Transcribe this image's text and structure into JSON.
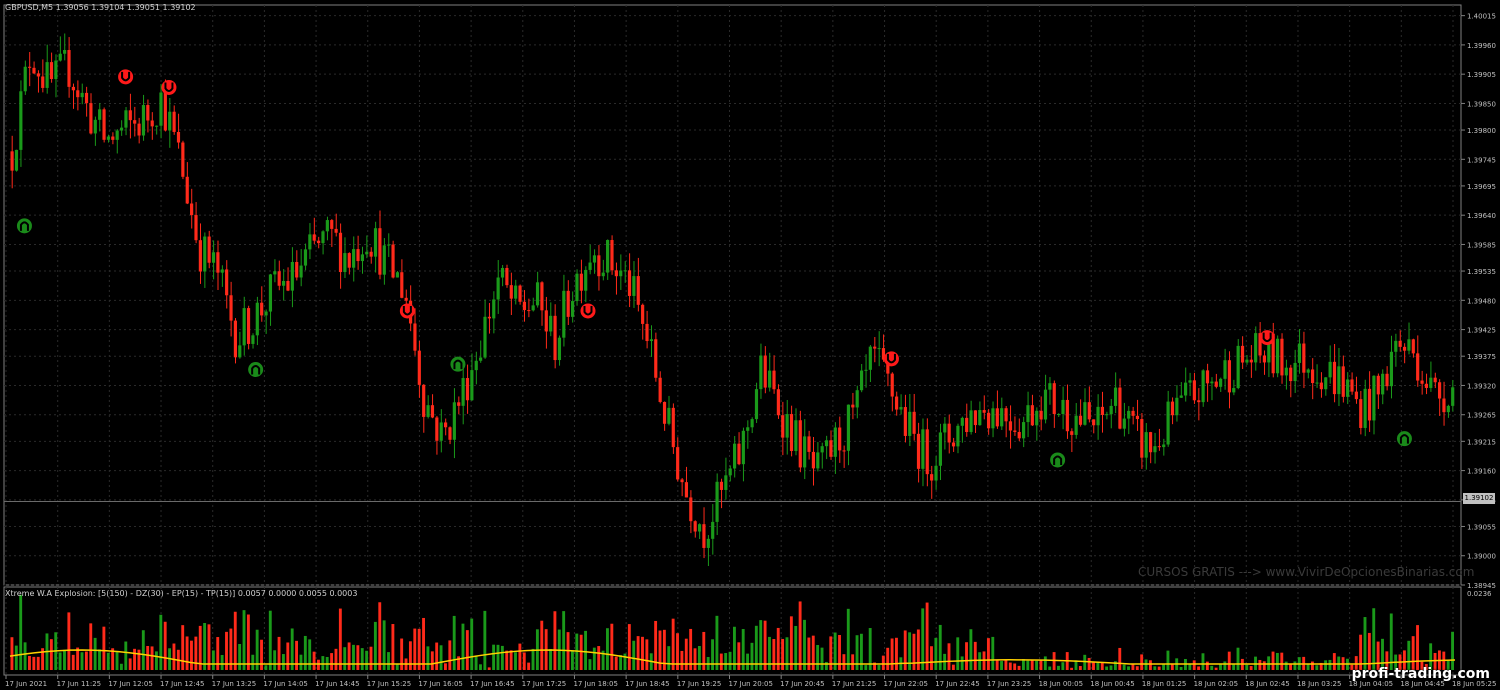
{
  "header": {
    "symbol_info": "GBPUSD,M5  1.39056 1.39104 1.39051 1.39102"
  },
  "indicator": {
    "title": "Xtreme W.A Explosion: [5(150) - DZ(30) - EP(15) - TP(15)] 0.0057 0.0000 0.0055 0.0003",
    "scale_label": "0.0236"
  },
  "watermark": "CURSOS GRATIS ---> www.VivirDeOpcionesBinarias.com",
  "brand": "profi-trading.com",
  "current_price": "1.39102",
  "colors": {
    "bull": "#1a9a1a",
    "bear": "#ff2a1a",
    "signal_line": "#ffd000",
    "grid": "#2a2a2a",
    "axis": "#808080"
  },
  "price_axis": [
    "1.40015",
    "1.39960",
    "1.39905",
    "1.39850",
    "1.39800",
    "1.39745",
    "1.39695",
    "1.39640",
    "1.39585",
    "1.39535",
    "1.39480",
    "1.39425",
    "1.39375",
    "1.39320",
    "1.39265",
    "1.39215",
    "1.39160",
    "1.39105",
    "1.39055",
    "1.39000",
    "1.38945"
  ],
  "time_axis": [
    "17 Jun 2021",
    "17 Jun 11:25",
    "17 Jun 12:05",
    "17 Jun 12:45",
    "17 Jun 13:25",
    "17 Jun 14:05",
    "17 Jun 14:45",
    "17 Jun 15:25",
    "17 Jun 16:05",
    "17 Jun 16:45",
    "17 Jun 17:25",
    "17 Jun 18:05",
    "17 Jun 18:45",
    "17 Jun 19:25",
    "17 Jun 20:05",
    "17 Jun 20:45",
    "17 Jun 21:25",
    "17 Jun 22:05",
    "17 Jun 22:45",
    "17 Jun 23:25",
    "18 Jun 00:05",
    "18 Jun 00:45",
    "18 Jun 01:25",
    "18 Jun 02:05",
    "18 Jun 02:45",
    "18 Jun 03:25",
    "18 Jun 04:05",
    "18 Jun 04:45",
    "18 Jun 05:25"
  ],
  "chart_data": {
    "type": "candlestick",
    "path": [
      1.3976,
      1.3995,
      1.3988,
      1.3992,
      1.3984,
      1.3978,
      1.398,
      1.3982,
      1.3986,
      1.3974,
      1.3958,
      1.3953,
      1.3941,
      1.3945,
      1.395,
      1.3952,
      1.3957,
      1.396,
      1.3956,
      1.3961,
      1.3955,
      1.395,
      1.393,
      1.3922,
      1.393,
      1.394,
      1.3952,
      1.3946,
      1.3948,
      1.394,
      1.3951,
      1.3958,
      1.3955,
      1.3951,
      1.394,
      1.3925,
      1.3912,
      1.3905,
      1.3912,
      1.392,
      1.3935,
      1.3928,
      1.3921,
      1.3915,
      1.3921,
      1.3926,
      1.3937,
      1.3931,
      1.3923,
      1.3918,
      1.3922,
      1.3926,
      1.3928,
      1.3927,
      1.3925,
      1.393,
      1.3928,
      1.3926,
      1.3924,
      1.393,
      1.3922,
      1.392,
      1.3926,
      1.393,
      1.3932,
      1.3935,
      1.3937,
      1.3938,
      1.3936,
      1.3937,
      1.3935,
      1.3933,
      1.3928,
      1.393,
      1.394,
      1.3938,
      1.393,
      1.3932
    ],
    "n_candles": 330,
    "ylim": [
      1.38945,
      1.40035
    ],
    "signals_buy": [
      [
        0.01,
        1.3962
      ],
      [
        0.17,
        1.3935
      ],
      [
        0.31,
        1.3936
      ],
      [
        0.725,
        1.3918
      ],
      [
        0.965,
        1.3922
      ]
    ],
    "signals_sell": [
      [
        0.08,
        1.399
      ],
      [
        0.11,
        1.3988
      ],
      [
        0.275,
        1.3946
      ],
      [
        0.4,
        1.3946
      ],
      [
        0.61,
        1.3937
      ],
      [
        0.87,
        1.3941
      ]
    ]
  }
}
